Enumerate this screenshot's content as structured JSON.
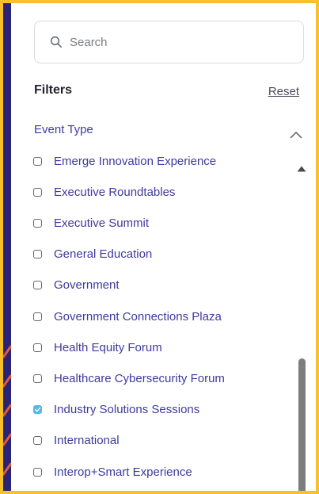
{
  "search": {
    "placeholder": "Search",
    "icon": "search-icon"
  },
  "filters": {
    "title": "Filters",
    "reset_label": "Reset"
  },
  "event_type": {
    "label": "Event Type",
    "expanded": true,
    "options": [
      {
        "label": "Emerge Innovation Experience",
        "checked": false
      },
      {
        "label": "Executive Roundtables",
        "checked": false
      },
      {
        "label": "Executive Summit",
        "checked": false
      },
      {
        "label": "General Education",
        "checked": false
      },
      {
        "label": "Government",
        "checked": false
      },
      {
        "label": "Government Connections Plaza",
        "checked": false
      },
      {
        "label": "Health Equity Forum",
        "checked": false
      },
      {
        "label": "Healthcare Cybersecurity Forum",
        "checked": false
      },
      {
        "label": "Industry Solutions Sessions",
        "checked": true
      },
      {
        "label": "International",
        "checked": false
      },
      {
        "label": "Interop+Smart Experience",
        "checked": false
      }
    ]
  },
  "colors": {
    "frame_border": "#f8c12b",
    "accent_text": "#3e3a9e",
    "checked_fill": "#58b6e9",
    "left_strip": "#2a2476"
  }
}
